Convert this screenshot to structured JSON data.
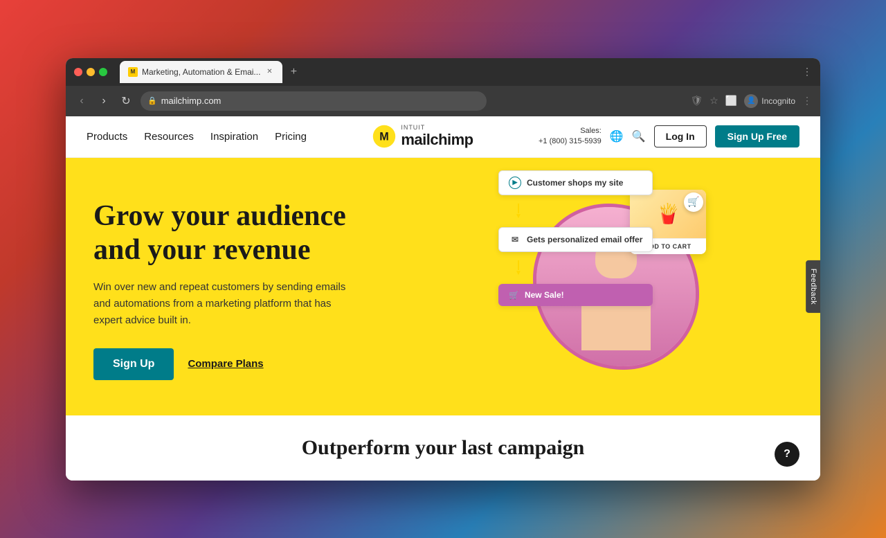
{
  "browser": {
    "tab_title": "Marketing, Automation & Emai...",
    "tab_favicon": "M",
    "url": "mailchimp.com",
    "incognito_label": "Incognito"
  },
  "nav": {
    "links": [
      {
        "label": "Products",
        "id": "products"
      },
      {
        "label": "Resources",
        "id": "resources"
      },
      {
        "label": "Inspiration",
        "id": "inspiration"
      },
      {
        "label": "Pricing",
        "id": "pricing"
      }
    ],
    "logo_intuit": "intuit",
    "logo_text": "mailchimp",
    "sales_label": "Sales:",
    "sales_phone": "+1 (800) 315-5939",
    "login_label": "Log In",
    "signup_label": "Sign Up Free"
  },
  "hero": {
    "title": "Grow your audience and your revenue",
    "subtitle": "Win over new and repeat customers by sending emails and automations from a marketing platform that has expert advice built in.",
    "signup_label": "Sign Up",
    "compare_label": "Compare Plans",
    "flow_step1": "Customer shops my site",
    "flow_step2": "Gets personalized email offer",
    "flow_step3": "New Sale!",
    "product_emoji": "🍟",
    "add_to_cart": "ADD TO CART",
    "cart_icon": "🛒"
  },
  "below_hero": {
    "title": "Outperform your last campaign"
  },
  "feedback": {
    "label": "Feedback"
  },
  "help": {
    "label": "?"
  }
}
